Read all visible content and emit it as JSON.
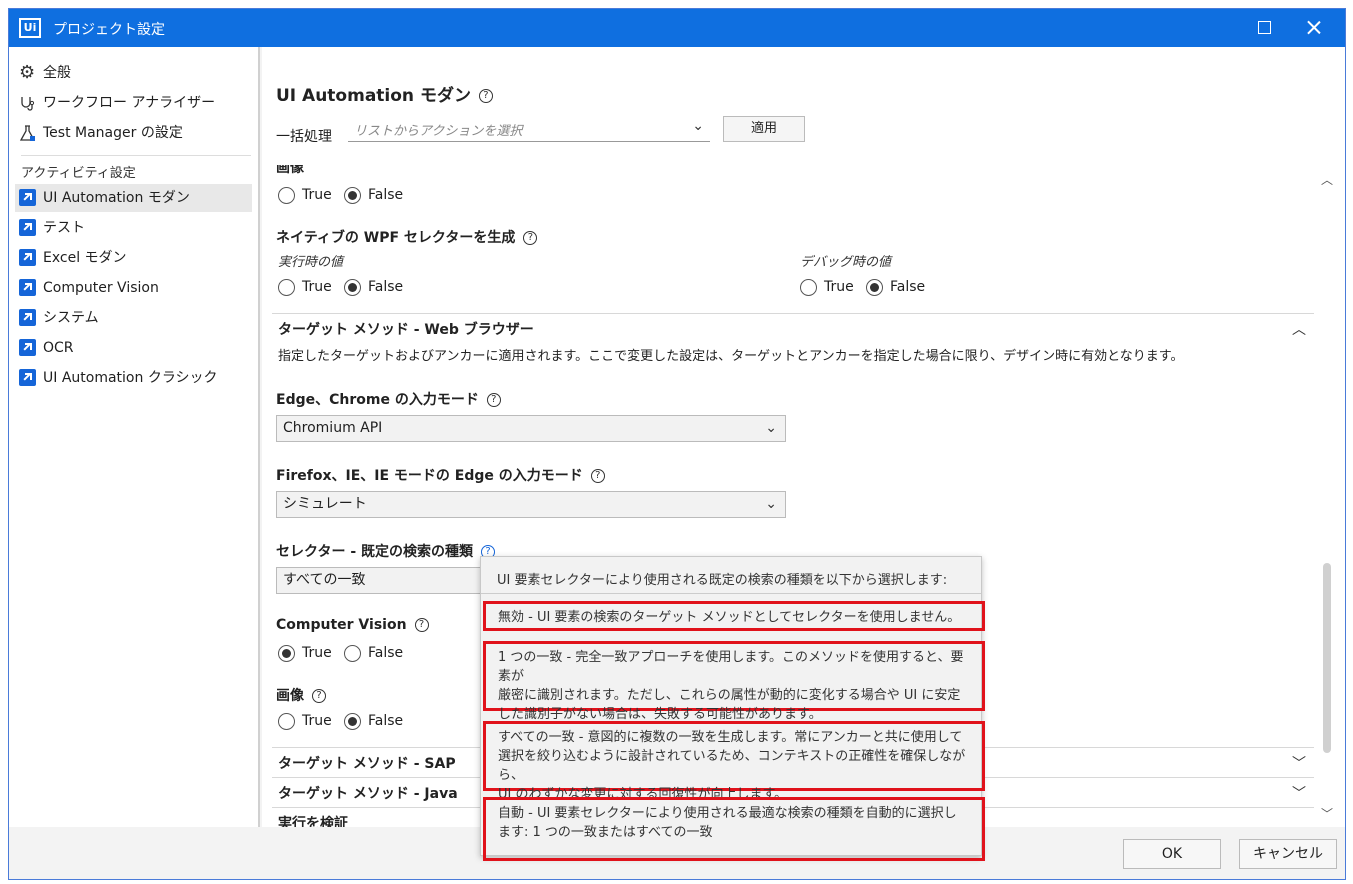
{
  "window": {
    "title": "プロジェクト設定",
    "logo": "Ui"
  },
  "sidebar": {
    "items_top": [
      {
        "label": "全般",
        "icon": "gear-icon"
      },
      {
        "label": "ワークフロー アナライザー",
        "icon": "workflow-analyzer-icon"
      },
      {
        "label": "Test Manager の設定",
        "icon": "flask-icon"
      }
    ],
    "heading": "アクティビティ設定",
    "items": [
      {
        "label": "UI Automation モダン",
        "icon": "activity-icon",
        "selected": true
      },
      {
        "label": "テスト",
        "icon": "activity-icon"
      },
      {
        "label": "Excel モダン",
        "icon": "activity-icon"
      },
      {
        "label": "Computer Vision",
        "icon": "activity-icon"
      },
      {
        "label": "システム",
        "icon": "activity-icon"
      },
      {
        "label": "OCR",
        "icon": "activity-icon"
      },
      {
        "label": "UI Automation クラシック",
        "icon": "activity-icon"
      }
    ]
  },
  "main": {
    "title": "UI Automation モダン",
    "bulk_label": "一括処理",
    "bulk_placeholder": "リストからアクションを選択",
    "apply_label": "適用",
    "partial_image_label": "画像",
    "true_label": "True",
    "false_label": "False",
    "wpf_label": "ネイティブの WPF セレクターを生成",
    "runtime_label": "実行時の値",
    "debug_label": "デバッグ時の値",
    "section_web": "ターゲット メソッド - Web ブラウザー",
    "section_web_desc": "指定したターゲットおよびアンカーに適用されます。ここで変更した設定は、ターゲットとアンカーを指定した場合に限り、デザイン時に有効となります。",
    "edge_chrome_label": "Edge、Chrome の入力モード",
    "edge_chrome_value": "Chromium API",
    "firefox_label": "Firefox、IE、IE モードの Edge の入力モード",
    "firefox_value": "シミュレート",
    "selector_label": "セレクター - 既定の検索の種類",
    "selector_value": "すべての一致",
    "cv_label": "Computer Vision",
    "image_label": "画像",
    "section_sap": "ターゲット メソッド - SAP",
    "section_java": "ターゲット メソッド - Java",
    "section_verify": "実行を検証"
  },
  "tooltip": {
    "header": "UI 要素セレクターにより使用される既定の検索の種類を以下から選択します:",
    "items": [
      {
        "lines": [
          "無効 - UI 要素の検索のターゲット メソッドとしてセレクターを使用しません。"
        ]
      },
      {
        "lines": [
          "1 つの一致 - 完全一致アプローチを使用します。このメソッドを使用すると、要素が",
          "厳密に識別されます。ただし、これらの属性が動的に変化する場合や UI に安定",
          "した識別子がない場合は、失敗する可能性があります。"
        ]
      },
      {
        "lines": [
          "すべての一致 - 意図的に複数の一致を生成します。常にアンカーと共に使用して",
          "選択を絞り込むように設計されているため、コンテキストの正確性を確保しながら、",
          "UI のわずかな変更に対する回復性が向上します。"
        ]
      },
      {
        "lines": [
          "自動 - UI 要素セレクターにより使用される最適な検索の種類を自動的に選択し",
          "ます: 1 つの一致またはすべての一致"
        ]
      }
    ],
    "highlight_color": "#e0121b"
  },
  "footer": {
    "ok_label": "OK",
    "cancel_label": "キャンセル"
  },
  "colors": {
    "titlebar": "#0f6fe0",
    "accent": "#1565d8"
  }
}
